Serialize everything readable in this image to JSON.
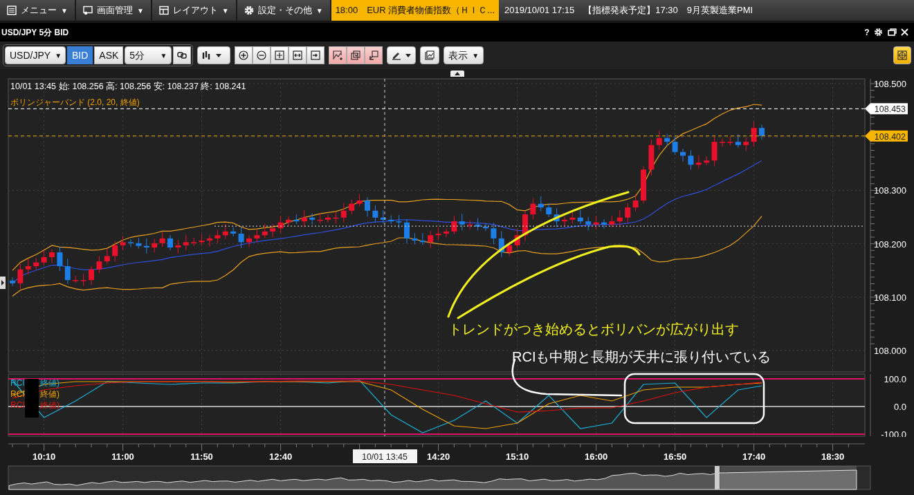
{
  "menu_bar": {
    "items": [
      {
        "label": "メニュー",
        "caret": "▼",
        "kind": "list"
      },
      {
        "label": "画面管理",
        "caret": "▼",
        "kind": "screen"
      },
      {
        "label": "レイアウト",
        "caret": "▼",
        "kind": "layout"
      },
      {
        "label": "設定・その他",
        "caret": "▼",
        "kind": "gear"
      }
    ],
    "ticker": [
      {
        "text": "18:00　EUR  消費者物価指数（ＨＩＣ...",
        "kind": "alert"
      },
      {
        "text": "2019/10/01 17:15　【指標発表予定】17:30　9月英製造業PMI",
        "kind": "schedule"
      }
    ]
  },
  "window": {
    "title": "USD/JPY 5分 BID",
    "help": "?"
  },
  "toolbar": {
    "symbol": "USD/JPY",
    "sides": [
      {
        "label": "BID",
        "selected": true
      },
      {
        "label": "ASK",
        "selected": false
      }
    ],
    "interval": "5分",
    "view_menu": "表示",
    "caret": "▼"
  },
  "price_chart": {
    "ohlc_label": "10/01 13:45  始:  108.256  高:  108.256  安:  108.237  終:  108.241",
    "indicator_label": "ボリンジャーバンド (2.0, 20, 終値)",
    "price_axis_labels": [
      "108.500",
      "108.300",
      "108.200",
      "108.100",
      "108.000"
    ],
    "price_tags": [
      {
        "value": "108.453",
        "kind": "marker"
      },
      {
        "value": "108.402",
        "kind": "current"
      }
    ]
  },
  "rci_chart": {
    "legend": [
      {
        "prefix": "RCI",
        "suffix": "終値)",
        "color": "#1ab0d8"
      },
      {
        "prefix": "RCI",
        "suffix": "終値)",
        "color": "#f0a000"
      },
      {
        "prefix": "RCI",
        "suffix": "終値)",
        "color": "#e01010"
      }
    ],
    "axis_labels": [
      "100.0",
      "0.0",
      "-100.0"
    ]
  },
  "time_axis": {
    "labels": [
      "10:10",
      "11:00",
      "11:50",
      "12:40",
      "14:20",
      "15:10",
      "16:00",
      "16:50",
      "17:40",
      "18:30"
    ],
    "crosshair_label": "10/01 13:45"
  },
  "annotations": [
    {
      "text": "トレンドがつき始めるとボリバンが広がり出す",
      "kind": "trend"
    },
    {
      "text": "RCIも中期と長期が天井に張り付いている",
      "kind": "note"
    }
  ]
}
